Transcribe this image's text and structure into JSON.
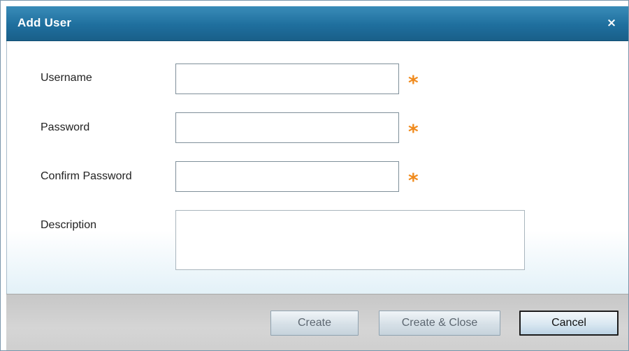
{
  "dialog": {
    "title": "Add User",
    "close_glyph": "×"
  },
  "form": {
    "fields": [
      {
        "label": "Username",
        "value": "",
        "required_marker": "*"
      },
      {
        "label": "Password",
        "value": "",
        "required_marker": "*"
      },
      {
        "label": "Confirm Password",
        "value": "",
        "required_marker": "*"
      },
      {
        "label": "Description",
        "value": ""
      }
    ]
  },
  "footer": {
    "create_label": "Create",
    "create_close_label": "Create & Close",
    "cancel_label": "Cancel"
  },
  "colors": {
    "title_bar": "#1f6f9e",
    "required_marker": "#f08a1c",
    "footer_bg": "#d0d0d0"
  },
  "icons": {
    "close": "close-icon",
    "required": "asterisk-icon"
  }
}
